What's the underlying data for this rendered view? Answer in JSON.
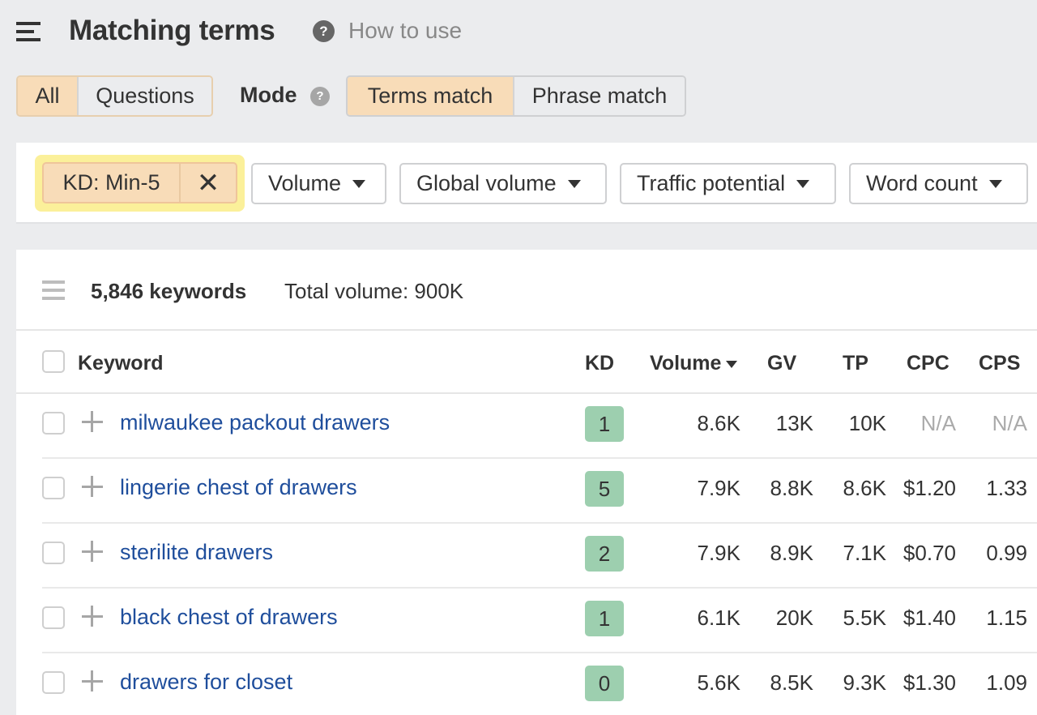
{
  "header": {
    "menu_icon": "hamburger-menu-icon",
    "title": "Matching terms",
    "help_icon_glyph": "?",
    "how_to_use": "How to use"
  },
  "type_tabs": [
    {
      "label": "All",
      "active": true
    },
    {
      "label": "Questions",
      "active": false
    }
  ],
  "mode": {
    "label": "Mode",
    "help_icon_glyph": "?",
    "options": [
      {
        "label": "Terms match",
        "active": true
      },
      {
        "label": "Phrase match",
        "active": false
      }
    ]
  },
  "filters": {
    "active_filter": {
      "label": "KD: Min-5",
      "remove_glyph": "✕"
    },
    "dropdowns": [
      {
        "label": "Volume"
      },
      {
        "label": "Global volume"
      },
      {
        "label": "Traffic potential"
      },
      {
        "label": "Word count"
      }
    ]
  },
  "summary": {
    "keyword_count": "5,846 keywords",
    "total_volume": "Total volume: 900K"
  },
  "table": {
    "columns": {
      "keyword": "Keyword",
      "kd": "KD",
      "volume": "Volume",
      "gv": "GV",
      "tp": "TP",
      "cpc": "CPC",
      "cps": "CPS"
    },
    "sorted_by": "Volume",
    "rows": [
      {
        "keyword": "milwaukee packout drawers",
        "kd": "1",
        "volume": "8.6K",
        "gv": "13K",
        "tp": "10K",
        "cpc": "N/A",
        "cps": "N/A"
      },
      {
        "keyword": "lingerie chest of drawers",
        "kd": "5",
        "volume": "7.9K",
        "gv": "8.8K",
        "tp": "8.6K",
        "cpc": "$1.20",
        "cps": "1.33"
      },
      {
        "keyword": "sterilite drawers",
        "kd": "2",
        "volume": "7.9K",
        "gv": "8.9K",
        "tp": "7.1K",
        "cpc": "$0.70",
        "cps": "0.99"
      },
      {
        "keyword": "black chest of drawers",
        "kd": "1",
        "volume": "6.1K",
        "gv": "20K",
        "tp": "5.5K",
        "cpc": "$1.40",
        "cps": "1.15"
      },
      {
        "keyword": "drawers for closet",
        "kd": "0",
        "volume": "5.6K",
        "gv": "8.5K",
        "tp": "9.3K",
        "cpc": "$1.30",
        "cps": "1.09"
      }
    ]
  },
  "colors": {
    "active_segment": "#f8dcb8",
    "filter_highlight": "#fbf09a",
    "kd_badge_easy": "#9dcfaf",
    "keyword_link": "#1f4e9c",
    "na_text": "#aaaaaa"
  }
}
